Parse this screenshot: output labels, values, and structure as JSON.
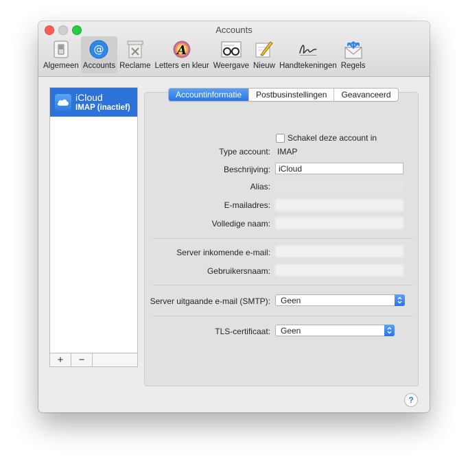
{
  "window": {
    "title": "Accounts"
  },
  "toolbar": {
    "items": [
      {
        "label": "Algemeen",
        "icon": "switch-icon"
      },
      {
        "label": "Accounts",
        "icon": "at-sign-icon",
        "selected": true
      },
      {
        "label": "Reclame",
        "icon": "trash-icon"
      },
      {
        "label": "Letters en kleur",
        "icon": "font-color-icon"
      },
      {
        "label": "Weergave",
        "icon": "glasses-icon"
      },
      {
        "label": "Nieuw",
        "icon": "pencil-icon"
      },
      {
        "label": "Handtekeningen",
        "icon": "signature-icon"
      },
      {
        "label": "Regels",
        "icon": "rules-icon"
      }
    ]
  },
  "accounts": {
    "items": [
      {
        "name": "iCloud",
        "subtitle": "IMAP (inactief)",
        "icon": "cloud-icon"
      }
    ],
    "add_label": "+",
    "remove_label": "−"
  },
  "tabs": [
    {
      "label": "Accountinformatie",
      "active": true
    },
    {
      "label": "Postbusinstellingen",
      "active": false
    },
    {
      "label": "Geavanceerd",
      "active": false
    }
  ],
  "form": {
    "enable_label": "Schakel deze account in",
    "type_label": "Type account:",
    "type_value": "IMAP",
    "description_label": "Beschrijving:",
    "description_value": "iCloud",
    "alias_label": "Alias:",
    "email_label": "E-mailadres:",
    "fullname_label": "Volledige naam:",
    "incoming_label": "Server inkomende e-mail:",
    "username_label": "Gebruikersnaam:",
    "smtp_label": "Server uitgaande e-mail (SMTP):",
    "smtp_value": "Geen",
    "tls_label": "TLS-certificaat:",
    "tls_value": "Geen"
  },
  "help": {
    "label": "?"
  },
  "colors": {
    "accent": "#2c72d9",
    "close": "#fc5f57",
    "maximize": "#2acb42"
  }
}
